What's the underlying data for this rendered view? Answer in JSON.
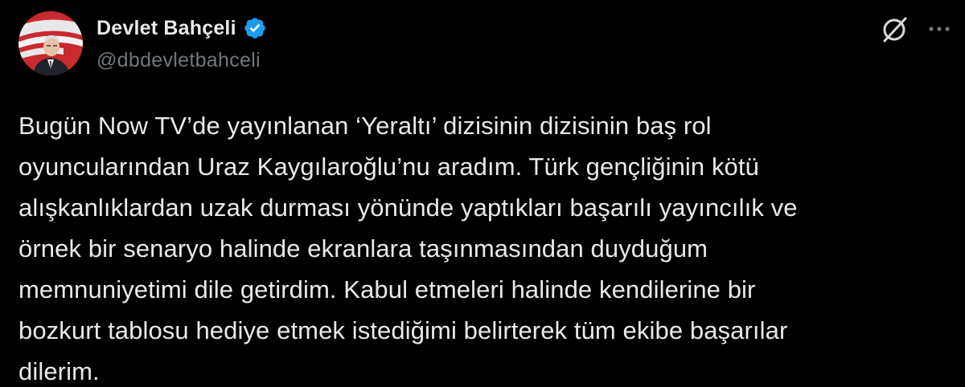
{
  "author": {
    "display_name": "Devlet Bahçeli",
    "handle": "@dbdevletbahceli",
    "verified": true,
    "avatar_icon": "profile-photo-with-turkish-flag"
  },
  "actions": {
    "grok_icon": "grok-icon",
    "more_icon": "more-horizontal-icon"
  },
  "tweet": {
    "text": "Bugün Now TV’de yayınlanan ‘Yeraltı’ dizisinin dizisinin baş rol\noyuncularından Uraz Kaygılaroğlu’nu aradım. Türk gençliğinin kötü\nalışkanlıklardan uzak durması yönünde yaptıkları başarılı yayıncılık ve\nörnek bir senaryo halinde ekranlara taşınmasından duyduğum\nmemnuniyetimi dile getirdim. Kabul etmeleri halinde kendilerine bir\nbozkurt tablosu hediye etmek istediğimi belirterek tüm ekibe başarılar\ndilerim."
  },
  "colors": {
    "background": "#000000",
    "text_primary": "#e7e9ea",
    "text_secondary": "#71767b",
    "verified_badge": "#1d9bf0",
    "flag_red": "#d52b2f"
  }
}
